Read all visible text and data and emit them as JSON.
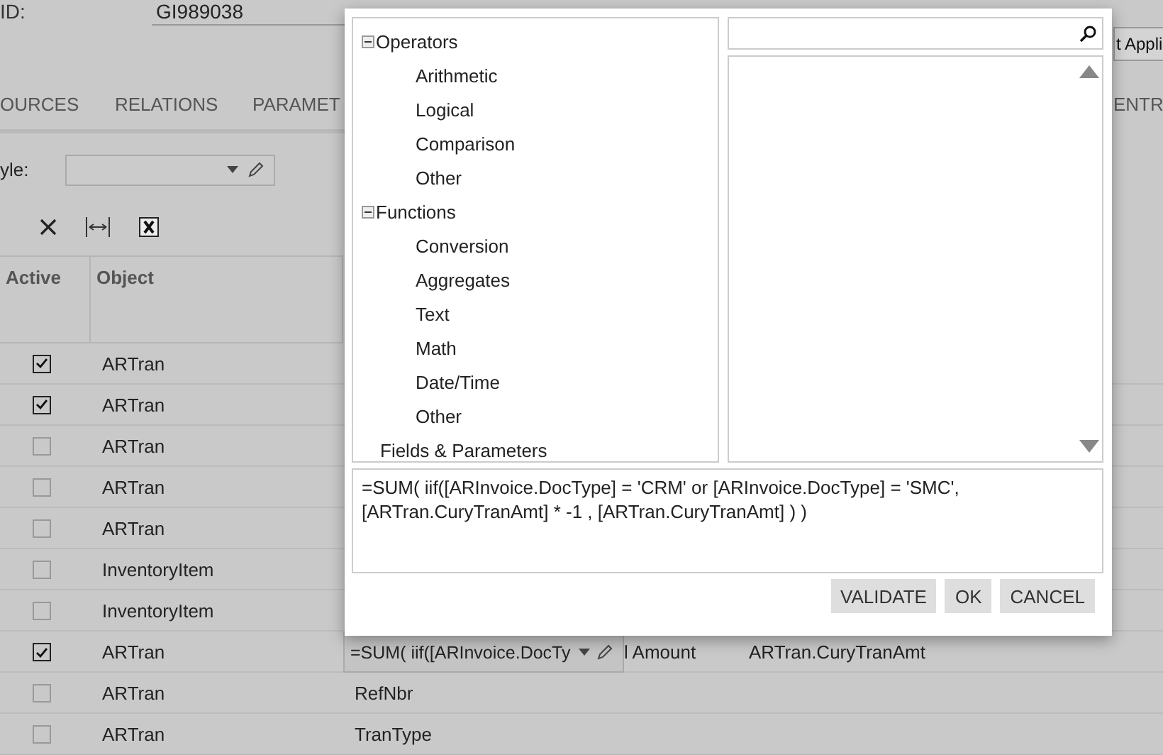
{
  "header": {
    "id_label": "ID:",
    "id_value": "GI989038",
    "apply_button": "t Appli"
  },
  "tabs": [
    {
      "label": "OURCES",
      "selected": false
    },
    {
      "label": "RELATIONS",
      "selected": false
    },
    {
      "label": "PARAMET",
      "selected": false
    },
    {
      "label": "ENTR",
      "selected": false
    }
  ],
  "style_label": "yle:",
  "grid": {
    "columns": [
      "Active",
      "Object"
    ],
    "rows": [
      {
        "active": true,
        "object": "ARTran"
      },
      {
        "active": true,
        "object": "ARTran"
      },
      {
        "active": false,
        "object": "ARTran"
      },
      {
        "active": false,
        "object": "ARTran"
      },
      {
        "active": false,
        "object": "ARTran"
      },
      {
        "active": false,
        "object": "InventoryItem"
      },
      {
        "active": false,
        "object": "InventoryItem"
      },
      {
        "active": true,
        "object": "ARTran",
        "editor": "=SUM( iif([ARInvoice.DocTy",
        "column_4": "l Amount",
        "column_5": "ARTran.CuryTranAmt"
      },
      {
        "active": false,
        "object": "ARTran",
        "column_3": "RefNbr"
      },
      {
        "active": false,
        "object": "ARTran",
        "column_3": "TranType"
      }
    ]
  },
  "dialog": {
    "tree": [
      {
        "label": "Operators",
        "expanded": true,
        "children": [
          {
            "label": "Arithmetic"
          },
          {
            "label": "Logical"
          },
          {
            "label": "Comparison"
          },
          {
            "label": "Other"
          }
        ]
      },
      {
        "label": "Functions",
        "expanded": true,
        "children": [
          {
            "label": "Conversion"
          },
          {
            "label": "Aggregates"
          },
          {
            "label": "Text"
          },
          {
            "label": "Math"
          },
          {
            "label": "Date/Time"
          },
          {
            "label": "Other"
          }
        ]
      },
      {
        "label": "Fields & Parameters"
      }
    ],
    "formula": "=SUM( iif([ARInvoice.DocType] = 'CRM' or [ARInvoice.DocType] = 'SMC',\n[ARTran.CuryTranAmt] * -1 , [ARTran.CuryTranAmt] ) )",
    "buttons": [
      "VALIDATE",
      "OK",
      "CANCEL"
    ]
  }
}
